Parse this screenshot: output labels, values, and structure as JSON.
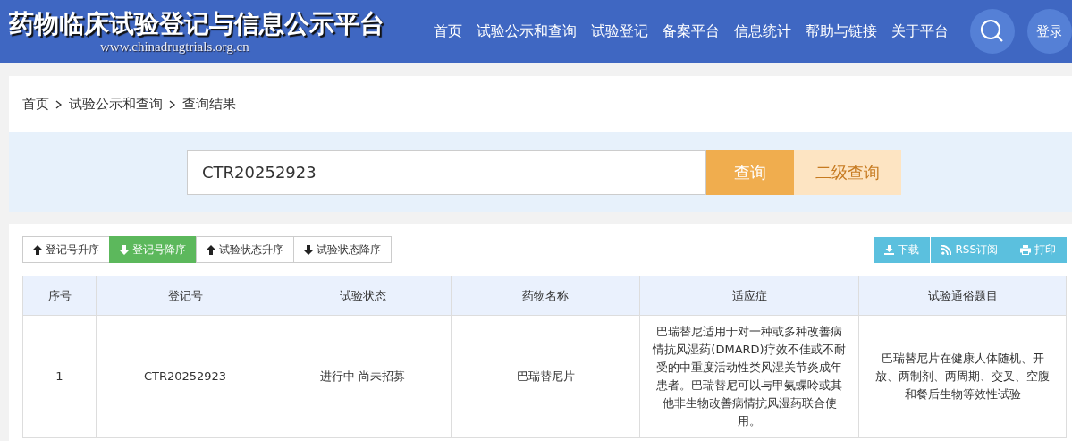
{
  "header": {
    "title": "药物临床试验登记与信息公示平台",
    "url": "www.chinadrugtrials.org.cn",
    "nav": [
      "首页",
      "试验公示和查询",
      "试验登记",
      "备案平台",
      "信息统计",
      "帮助与链接",
      "关于平台"
    ],
    "login": "登录"
  },
  "breadcrumb": [
    "首页",
    "试验公示和查询",
    "查询结果"
  ],
  "search": {
    "value": "CTR20252923",
    "buttons": [
      {
        "label": "查询",
        "kind": "primary"
      },
      {
        "label": "二级查询",
        "kind": "secondary"
      }
    ]
  },
  "sort_buttons": [
    {
      "label": "登记号升序",
      "kind": "up",
      "selected": false
    },
    {
      "label": "登记号降序",
      "kind": "down",
      "selected": true
    },
    {
      "label": "试验状态升序",
      "kind": "up",
      "selected": false
    },
    {
      "label": "试验状态降序",
      "kind": "down",
      "selected": false
    }
  ],
  "actions": [
    {
      "label": "下载",
      "kind": "download"
    },
    {
      "label": "RSS订阅",
      "kind": "rss"
    },
    {
      "label": "打印",
      "kind": "print"
    }
  ],
  "table": {
    "columns": [
      "序号",
      "登记号",
      "试验状态",
      "药物名称",
      "适应症",
      "试验通俗题目"
    ],
    "rows": [
      [
        "1",
        "CTR20252923",
        "进行中 尚未招募",
        "巴瑞替尼片",
        "巴瑞替尼适用于对一种或多种改善病情抗风湿药(DMARD)疗效不佳或不耐受的中重度活动性类风湿关节炎成年患者。巴瑞替尼可以与甲氨蝶呤或其他非生物改善病情抗风湿药联合使用。",
        "巴瑞替尼片在健康人体随机、开放、两制剂、两周期、交叉、空腹和餐后生物等效性试验"
      ]
    ]
  }
}
